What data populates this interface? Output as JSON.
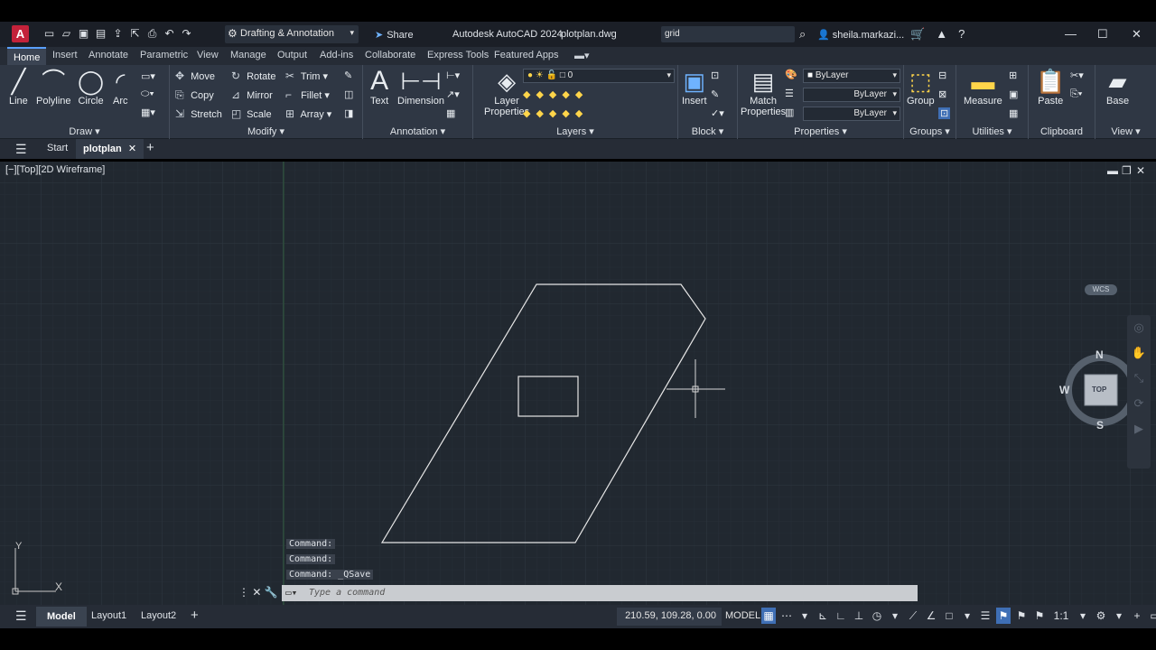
{
  "app": {
    "logo_letter": "A",
    "title": "Autodesk AutoCAD 2024",
    "file": "plotplan.dwg",
    "workspace": "Drafting & Annotation",
    "share_label": "Share",
    "search_value": "grid",
    "user": "sheila.markazi..."
  },
  "ribbon_tabs": [
    "Home",
    "Insert",
    "Annotate",
    "Parametric",
    "View",
    "Manage",
    "Output",
    "Add-ins",
    "Collaborate",
    "Express Tools",
    "Featured Apps"
  ],
  "ribbon": {
    "draw": {
      "title": "Draw",
      "line": "Line",
      "polyline": "Polyline",
      "circle": "Circle",
      "arc": "Arc"
    },
    "modify": {
      "title": "Modify",
      "move": "Move",
      "rotate": "Rotate",
      "trim": "Trim",
      "copy": "Copy",
      "mirror": "Mirror",
      "fillet": "Fillet",
      "stretch": "Stretch",
      "scale": "Scale",
      "array": "Array"
    },
    "annotation": {
      "title": "Annotation",
      "text": "Text",
      "dimension": "Dimension"
    },
    "layers": {
      "title": "Layers",
      "layer_properties_1": "Layer",
      "layer_properties_2": "Properties",
      "current_layer": "0"
    },
    "block": {
      "title": "Block",
      "insert": "Insert"
    },
    "properties": {
      "title": "Properties",
      "match_1": "Match",
      "match_2": "Properties",
      "color": "ByLayer",
      "linetype": "ByLayer",
      "lineweight": "ByLayer"
    },
    "groups": {
      "title": "Groups",
      "group": "Group"
    },
    "utilities": {
      "title": "Utilities",
      "measure": "Measure"
    },
    "clipboard": {
      "title": "Clipboard",
      "paste": "Paste"
    },
    "view": {
      "title": "View",
      "base": "Base"
    }
  },
  "doc_tabs": {
    "start": "Start",
    "active": "plotplan"
  },
  "viewport": {
    "label": "[−][Top][2D Wireframe]",
    "viewcube": {
      "n": "N",
      "s": "S",
      "e": "E",
      "w": "W",
      "face": "TOP",
      "wcs": "WCS"
    },
    "ucs": {
      "x": "X",
      "y": "Y"
    }
  },
  "command": {
    "history": [
      "Command:",
      "Command:",
      "Command: _QSave"
    ],
    "placeholder": "Type a command"
  },
  "status": {
    "model_tab": "Model",
    "layout1": "Layout1",
    "layout2": "Layout2",
    "coords": "210.59, 109.28, 0.00",
    "model_label": "MODEL",
    "scale": "1:1"
  }
}
